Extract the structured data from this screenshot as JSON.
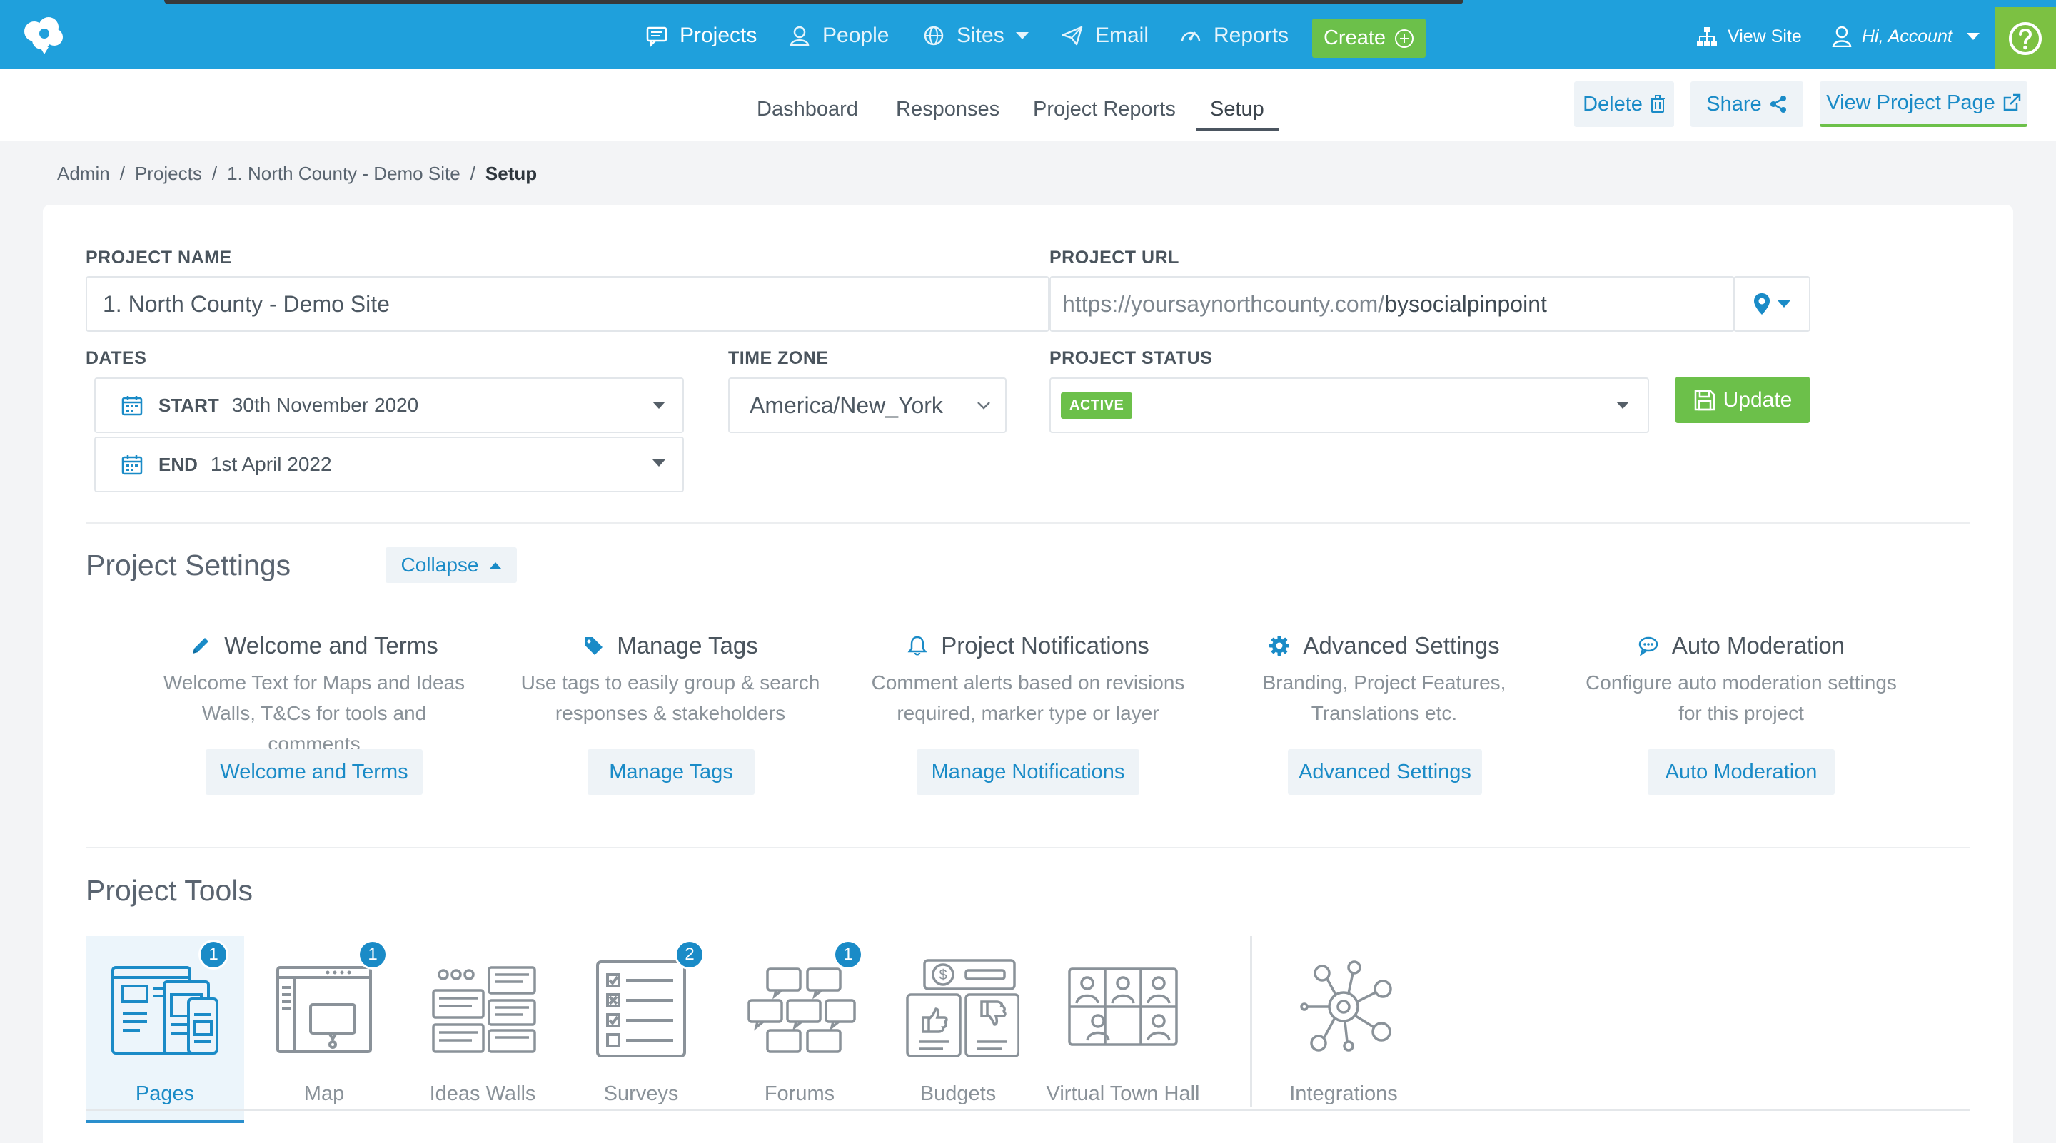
{
  "nav": {
    "projects": "Projects",
    "people": "People",
    "sites": "Sites",
    "email": "Email",
    "reports": "Reports",
    "create": "Create",
    "view_site": "View Site",
    "account": "Hi, Account"
  },
  "tabs": [
    "Dashboard",
    "Responses",
    "Project Reports",
    "Setup"
  ],
  "actions": {
    "delete": "Delete",
    "share": "Share",
    "view_project": "View Project Page"
  },
  "breadcrumb": [
    "Admin",
    "Projects",
    "1. North County - Demo Site",
    "Setup"
  ],
  "form": {
    "project_name_label": "PROJECT NAME",
    "project_name": "1. North County - Demo Site",
    "project_url_label": "PROJECT URL",
    "url_prefix": "https://yoursaynorthcounty.com/",
    "url_slug": "bysocialpinpoint",
    "dates_label": "DATES",
    "start_label": "START",
    "start_value": "30th November 2020",
    "end_label": "END",
    "end_value": "1st April 2022",
    "timezone_label": "TIME ZONE",
    "timezone": "America/New_York",
    "status_label": "PROJECT STATUS",
    "status": "ACTIVE",
    "update": "Update"
  },
  "settings": {
    "title": "Project Settings",
    "collapse": "Collapse",
    "items": [
      {
        "title": "Welcome and Terms",
        "desc1": "Welcome Text for Maps and Ideas",
        "desc2": "Walls, T&Cs for tools and comments",
        "button": "Welcome and Terms",
        "icon": "pencil-icon"
      },
      {
        "title": "Manage Tags",
        "desc1": "Use tags to easily group & search",
        "desc2": "responses & stakeholders",
        "button": "Manage Tags",
        "icon": "tag-icon"
      },
      {
        "title": "Project Notifications",
        "desc1": "Comment alerts based on revisions",
        "desc2": "required, marker type or layer",
        "button": "Manage Notifications",
        "icon": "bell-icon"
      },
      {
        "title": "Advanced Settings",
        "desc1": "Branding, Project Features,",
        "desc2": "Translations etc.",
        "button": "Advanced Settings",
        "icon": "gear-icon"
      },
      {
        "title": "Auto Moderation",
        "desc1": "Configure auto moderation settings",
        "desc2": "for this project",
        "button": "Auto Moderation",
        "icon": "chat-icon"
      }
    ]
  },
  "tools": {
    "title": "Project Tools",
    "items": [
      {
        "label": "Pages",
        "badge": "1"
      },
      {
        "label": "Map",
        "badge": "1"
      },
      {
        "label": "Ideas Walls",
        "badge": ""
      },
      {
        "label": "Surveys",
        "badge": "2"
      },
      {
        "label": "Forums",
        "badge": "1"
      },
      {
        "label": "Budgets",
        "badge": ""
      },
      {
        "label": "Virtual Town Hall",
        "badge": ""
      },
      {
        "label": "Integrations",
        "badge": ""
      }
    ]
  },
  "colors": {
    "brand_blue": "#1fa0dc",
    "accent_green": "#6cc04a",
    "link_blue": "#1a8bc7"
  }
}
